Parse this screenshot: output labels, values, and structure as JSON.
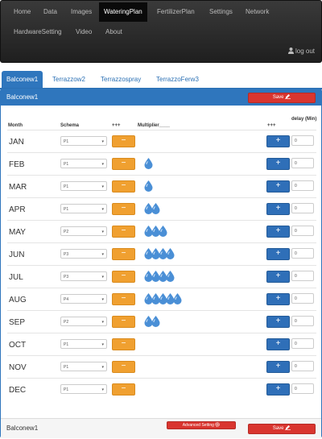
{
  "nav": {
    "items": [
      "Home",
      "Data",
      "Images",
      "WateringPlan",
      "FertilizerPlan",
      "Settings",
      "Network",
      "HardwareSetting",
      "Video",
      "About"
    ],
    "logout": "log out"
  },
  "tabs": [
    "Balconew1",
    "Terrazzow2",
    "Terrazzospray",
    "TerrazzoFerw3"
  ],
  "panel": {
    "title": "Balconew1",
    "save_label": "Save",
    "footer_title": "Balconew1",
    "advanced_label": "Advanced Setting"
  },
  "table": {
    "headers": {
      "month": "Month",
      "schema": "Schema",
      "minus": "+++",
      "multiplier": "Multiplier____",
      "plus": "+++",
      "delay": "delay (Min)"
    },
    "rows": [
      {
        "month": "JAN",
        "schema": "P1",
        "drops": 0,
        "delay": "0"
      },
      {
        "month": "FEB",
        "schema": "P1",
        "drops": 1,
        "delay": "0"
      },
      {
        "month": "MAR",
        "schema": "P1",
        "drops": 1,
        "delay": "0"
      },
      {
        "month": "APR",
        "schema": "P1",
        "drops": 2,
        "delay": "0"
      },
      {
        "month": "MAY",
        "schema": "P2",
        "drops": 3,
        "delay": "0"
      },
      {
        "month": "JUN",
        "schema": "P3",
        "drops": 4,
        "delay": "0"
      },
      {
        "month": "JUL",
        "schema": "P3",
        "drops": 4,
        "delay": "0"
      },
      {
        "month": "AUG",
        "schema": "P4",
        "drops": 5,
        "delay": "0"
      },
      {
        "month": "SEP",
        "schema": "P2",
        "drops": 2,
        "delay": "0"
      },
      {
        "month": "OCT",
        "schema": "P1",
        "drops": 0,
        "delay": "0"
      },
      {
        "month": "NOV",
        "schema": "P1",
        "drops": 0,
        "delay": "0"
      },
      {
        "month": "DEC",
        "schema": "P1",
        "drops": 0,
        "delay": "0"
      }
    ],
    "minus_symbol": "−",
    "plus_symbol": "+"
  },
  "colors": {
    "primary": "#2f76bd",
    "danger": "#d9352f",
    "warning": "#f0a030",
    "drop": "#4a8fd6"
  },
  "icons": {
    "user": "user-icon",
    "save": "edit-icon",
    "advanced": "gear-icon",
    "drop": "water-drop-icon",
    "caret": "caret-down-icon"
  }
}
